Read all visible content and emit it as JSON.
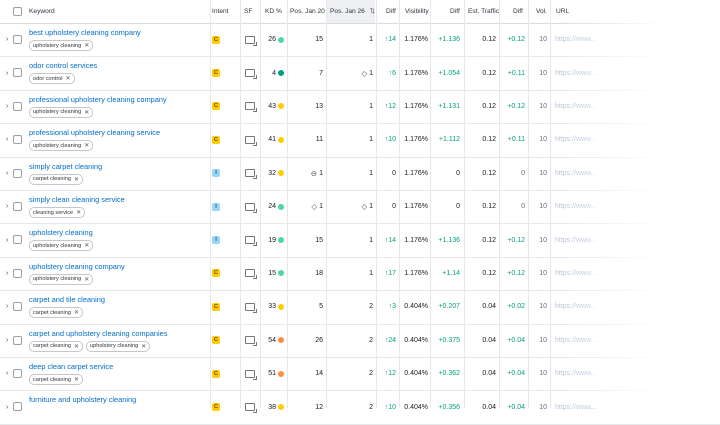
{
  "header": {
    "keyword": "Keyword",
    "intent": "Intent",
    "sf": "SF",
    "kd": "KD %",
    "pos_prev": "Pos. Jan 20",
    "pos_cur": "Pos. Jan 26",
    "diff": "Diff",
    "visibility": "Visibility",
    "vis_diff": "Diff",
    "traffic": "Est. Traffic",
    "traffic_diff": "Diff",
    "vol": "Vol.",
    "url": "URL"
  },
  "colors": {
    "link": "#006dca",
    "positive": "#009f81",
    "intent_C": "#ffcc00",
    "intent_I": "#9ad6f6",
    "kd_yellow": "#ffcc00",
    "kd_green": "#4fd6a8",
    "kd_dark_green": "#009f81",
    "kd_orange": "#ff8c43"
  },
  "rows": [
    {
      "keyword": "best upholstery cleaning company",
      "tags": [
        "upholstery cleaning"
      ],
      "intent": "C",
      "kd": "26",
      "kd_color": "#4fd6a8",
      "pos_prev": "15",
      "pos_prev_icon": "",
      "pos_cur": "1",
      "pos_cur_icon": "",
      "diff": "14",
      "diff_dir": "up",
      "visibility": "1.176%",
      "vis_diff": "+1.136",
      "traffic": "0.12",
      "traffic_diff": "+0.12",
      "vol": "10",
      "url": "https://www..."
    },
    {
      "keyword": "odor control services",
      "tags": [
        "odor control"
      ],
      "intent": "C",
      "kd": "4",
      "kd_color": "#009f81",
      "pos_prev": "7",
      "pos_prev_icon": "",
      "pos_cur": "1",
      "pos_cur_icon": "◇",
      "diff": "6",
      "diff_dir": "up",
      "visibility": "1.176%",
      "vis_diff": "+1.054",
      "traffic": "0.12",
      "traffic_diff": "+0.11",
      "vol": "10",
      "url": "https://www..."
    },
    {
      "keyword": "professional upholstery cleaning company",
      "tags": [
        "upholstery cleaning"
      ],
      "intent": "C",
      "kd": "43",
      "kd_color": "#ffcc00",
      "pos_prev": "13",
      "pos_prev_icon": "",
      "pos_cur": "1",
      "pos_cur_icon": "",
      "diff": "12",
      "diff_dir": "up",
      "visibility": "1.176%",
      "vis_diff": "+1.131",
      "traffic": "0.12",
      "traffic_diff": "+0.12",
      "vol": "10",
      "url": "https://www..."
    },
    {
      "keyword": "professional upholstery cleaning service",
      "tags": [
        "upholstery cleaning"
      ],
      "intent": "C",
      "kd": "41",
      "kd_color": "#ffcc00",
      "pos_prev": "11",
      "pos_prev_icon": "",
      "pos_cur": "1",
      "pos_cur_icon": "",
      "diff": "10",
      "diff_dir": "up",
      "visibility": "1.176%",
      "vis_diff": "+1.112",
      "traffic": "0.12",
      "traffic_diff": "+0.11",
      "vol": "10",
      "url": "https://www..."
    },
    {
      "keyword": "simply carpet cleaning",
      "tags": [
        "carpet cleaning"
      ],
      "intent": "I",
      "kd": "32",
      "kd_color": "#ffcc00",
      "pos_prev": "1",
      "pos_prev_icon": "⊖",
      "pos_cur": "1",
      "pos_cur_icon": "",
      "diff": "0",
      "diff_dir": "none",
      "visibility": "1.176%",
      "vis_diff": "0",
      "traffic": "0.12",
      "traffic_diff": "0",
      "vol": "10",
      "url": "https://www..."
    },
    {
      "keyword": "simply clean cleaning service",
      "tags": [
        "cleaning service"
      ],
      "intent": "I",
      "kd": "24",
      "kd_color": "#4fd6a8",
      "pos_prev": "1",
      "pos_prev_icon": "◇",
      "pos_cur": "1",
      "pos_cur_icon": "◇",
      "diff": "0",
      "diff_dir": "none",
      "visibility": "1.176%",
      "vis_diff": "0",
      "traffic": "0.12",
      "traffic_diff": "0",
      "vol": "10",
      "url": "https://www..."
    },
    {
      "keyword": "upholstery cleaning",
      "tags": [
        "upholstery cleaning"
      ],
      "intent": "I",
      "kd": "19",
      "kd_color": "#4fd6a8",
      "pos_prev": "15",
      "pos_prev_icon": "",
      "pos_cur": "1",
      "pos_cur_icon": "",
      "diff": "14",
      "diff_dir": "up",
      "visibility": "1.176%",
      "vis_diff": "+1.136",
      "traffic": "0.12",
      "traffic_diff": "+0.12",
      "vol": "10",
      "url": "https://www..."
    },
    {
      "keyword": "upholstery cleaning company",
      "tags": [
        "upholstery cleaning"
      ],
      "intent": "C",
      "kd": "15",
      "kd_color": "#4fd6a8",
      "pos_prev": "18",
      "pos_prev_icon": "",
      "pos_cur": "1",
      "pos_cur_icon": "",
      "diff": "17",
      "diff_dir": "up",
      "visibility": "1.176%",
      "vis_diff": "+1.14",
      "traffic": "0.12",
      "traffic_diff": "+0.12",
      "vol": "10",
      "url": "https://www..."
    },
    {
      "keyword": "carpet and tile cleaning",
      "tags": [
        "carpet cleaning"
      ],
      "intent": "C",
      "kd": "33",
      "kd_color": "#ffcc00",
      "pos_prev": "5",
      "pos_prev_icon": "",
      "pos_cur": "2",
      "pos_cur_icon": "",
      "diff": "3",
      "diff_dir": "up",
      "visibility": "0.404%",
      "vis_diff": "+0.207",
      "traffic": "0.04",
      "traffic_diff": "+0.02",
      "vol": "10",
      "url": "https://www..."
    },
    {
      "keyword": "carpet and upholstery cleaning companies",
      "tags": [
        "carpet cleaning",
        "upholstery cleaning"
      ],
      "intent": "C",
      "kd": "54",
      "kd_color": "#ff8c43",
      "pos_prev": "26",
      "pos_prev_icon": "",
      "pos_cur": "2",
      "pos_cur_icon": "",
      "diff": "24",
      "diff_dir": "up",
      "visibility": "0.404%",
      "vis_diff": "+0.375",
      "traffic": "0.04",
      "traffic_diff": "+0.04",
      "vol": "10",
      "url": "https://www..."
    },
    {
      "keyword": "deep clean carpet service",
      "tags": [
        "carpet cleaning"
      ],
      "intent": "C",
      "kd": "51",
      "kd_color": "#ff8c43",
      "pos_prev": "14",
      "pos_prev_icon": "",
      "pos_cur": "2",
      "pos_cur_icon": "",
      "diff": "12",
      "diff_dir": "up",
      "visibility": "0.404%",
      "vis_diff": "+0.362",
      "traffic": "0.04",
      "traffic_diff": "+0.04",
      "vol": "10",
      "url": "https://www..."
    },
    {
      "keyword": "furniture and upholstery cleaning",
      "tags": [],
      "intent": "C",
      "kd": "38",
      "kd_color": "#ffcc00",
      "pos_prev": "12",
      "pos_prev_icon": "",
      "pos_cur": "2",
      "pos_cur_icon": "",
      "diff": "10",
      "diff_dir": "up",
      "visibility": "0.404%",
      "vis_diff": "+0.356",
      "traffic": "0.04",
      "traffic_diff": "+0.04",
      "vol": "10",
      "url": "https://www..."
    }
  ]
}
